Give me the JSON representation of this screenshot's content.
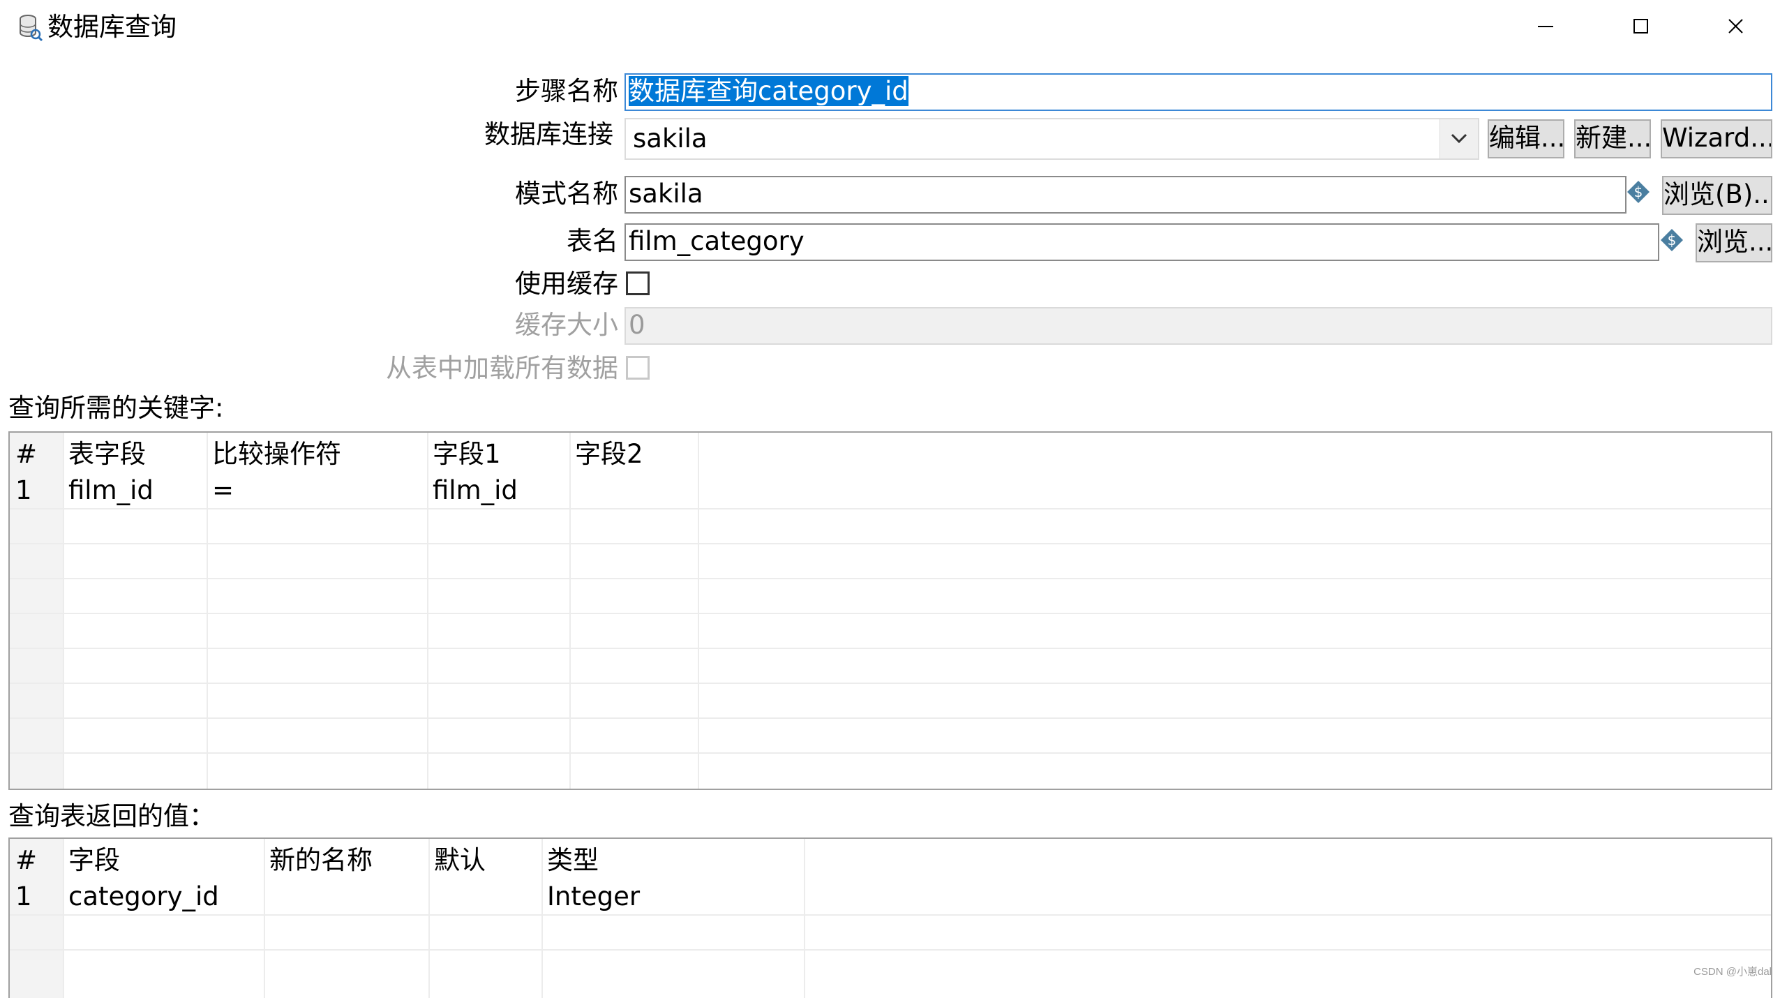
{
  "window": {
    "title": "数据库查询",
    "controls": {
      "minimize": "minimize-icon",
      "maximize": "maximize-icon",
      "close": "close-icon"
    }
  },
  "form": {
    "step_name": {
      "label": "步骤名称",
      "value": "数据库查询category_id"
    },
    "connection": {
      "label": "数据库连接",
      "value": "sakila",
      "edit": "编辑...",
      "new": "新建...",
      "wizard": "Wizard..."
    },
    "schema": {
      "label": "模式名称",
      "value": "sakila",
      "browse": "浏览(B)..."
    },
    "table": {
      "label": "表名",
      "value": "film_category",
      "browse": "浏览..."
    },
    "use_cache": {
      "label": "使用缓存",
      "checked": false
    },
    "cache_size": {
      "label": "缓存大小",
      "value": "0",
      "enabled": false
    },
    "load_all": {
      "label": "从表中加载所有数据",
      "checked": false,
      "enabled": false
    }
  },
  "keys_section": {
    "title": "查询所需的关键字:",
    "columns": [
      "#",
      "表字段",
      "比较操作符",
      "字段1",
      "字段2"
    ],
    "rows": [
      {
        "num": "1",
        "table_field": "film_id",
        "comparator": "=",
        "field1": "film_id",
        "field2": ""
      }
    ]
  },
  "returns_section": {
    "title": "查询表返回的值：",
    "columns": [
      "#",
      "字段",
      "新的名称",
      "默认",
      "类型"
    ],
    "rows": [
      {
        "num": "1",
        "field": "category_id",
        "new_name": "",
        "default": "",
        "type": "Integer"
      }
    ]
  },
  "watermark": "CSDN @小崽dal",
  "colors": {
    "selection": "#0078d7",
    "focus_border": "#3c88d6",
    "variable_icon": "#4a7ea0"
  }
}
